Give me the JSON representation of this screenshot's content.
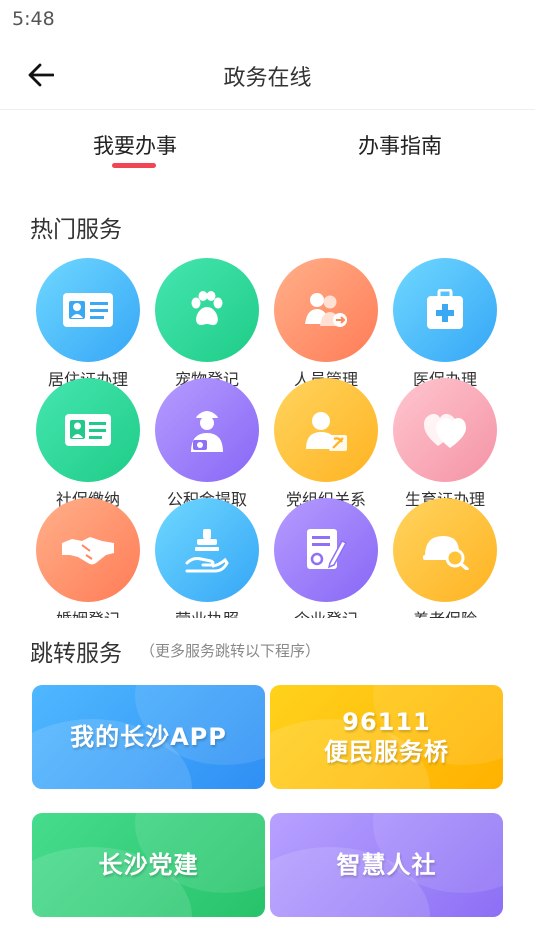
{
  "status_bar": {
    "time": "5:48"
  },
  "nav": {
    "title": "政务在线",
    "back_icon": "arrow-left-icon"
  },
  "tabs": [
    {
      "label": "我要办事",
      "active": true
    },
    {
      "label": "办事指南",
      "active": false
    }
  ],
  "accent_color": "#f04552",
  "hot_services": {
    "title": "热门服务",
    "items": [
      {
        "label": "居住证办理",
        "icon": "id-card-icon",
        "color": "blue"
      },
      {
        "label": "宠物登记",
        "icon": "paw-icon",
        "color": "green"
      },
      {
        "label": "人员管理",
        "icon": "people-transfer-icon",
        "color": "orange"
      },
      {
        "label": "医保办理",
        "icon": "medical-kit-icon",
        "color": "blue"
      },
      {
        "label": "社保缴纳",
        "icon": "id-card-icon",
        "color": "green"
      },
      {
        "label": "公积金提取",
        "icon": "worker-icon",
        "color": "purple"
      },
      {
        "label": "党组织关系",
        "icon": "party-member-icon",
        "color": "yellow"
      },
      {
        "label": "生育证办理",
        "icon": "heart-icon",
        "color": "pink"
      },
      {
        "label": "婚姻登记",
        "icon": "handshake-icon",
        "color": "orange"
      },
      {
        "label": "营业执照",
        "icon": "stamp-hand-icon",
        "color": "blue"
      },
      {
        "label": "企业登记",
        "icon": "document-edit-icon",
        "color": "purple"
      },
      {
        "label": "养老保险",
        "icon": "helmet-search-icon",
        "color": "yellow"
      }
    ]
  },
  "jump_services": {
    "title": "跳转服务",
    "note": "（更多服务跳转以下程序）",
    "cards": [
      {
        "line1": "我的长沙APP",
        "line2": "",
        "color": "blue"
      },
      {
        "line1": "96111",
        "line2": "便民服务桥",
        "color": "yellow"
      },
      {
        "line1": "长沙党建",
        "line2": "",
        "color": "green"
      },
      {
        "line1": "智慧人社",
        "line2": "",
        "color": "purple"
      }
    ]
  }
}
